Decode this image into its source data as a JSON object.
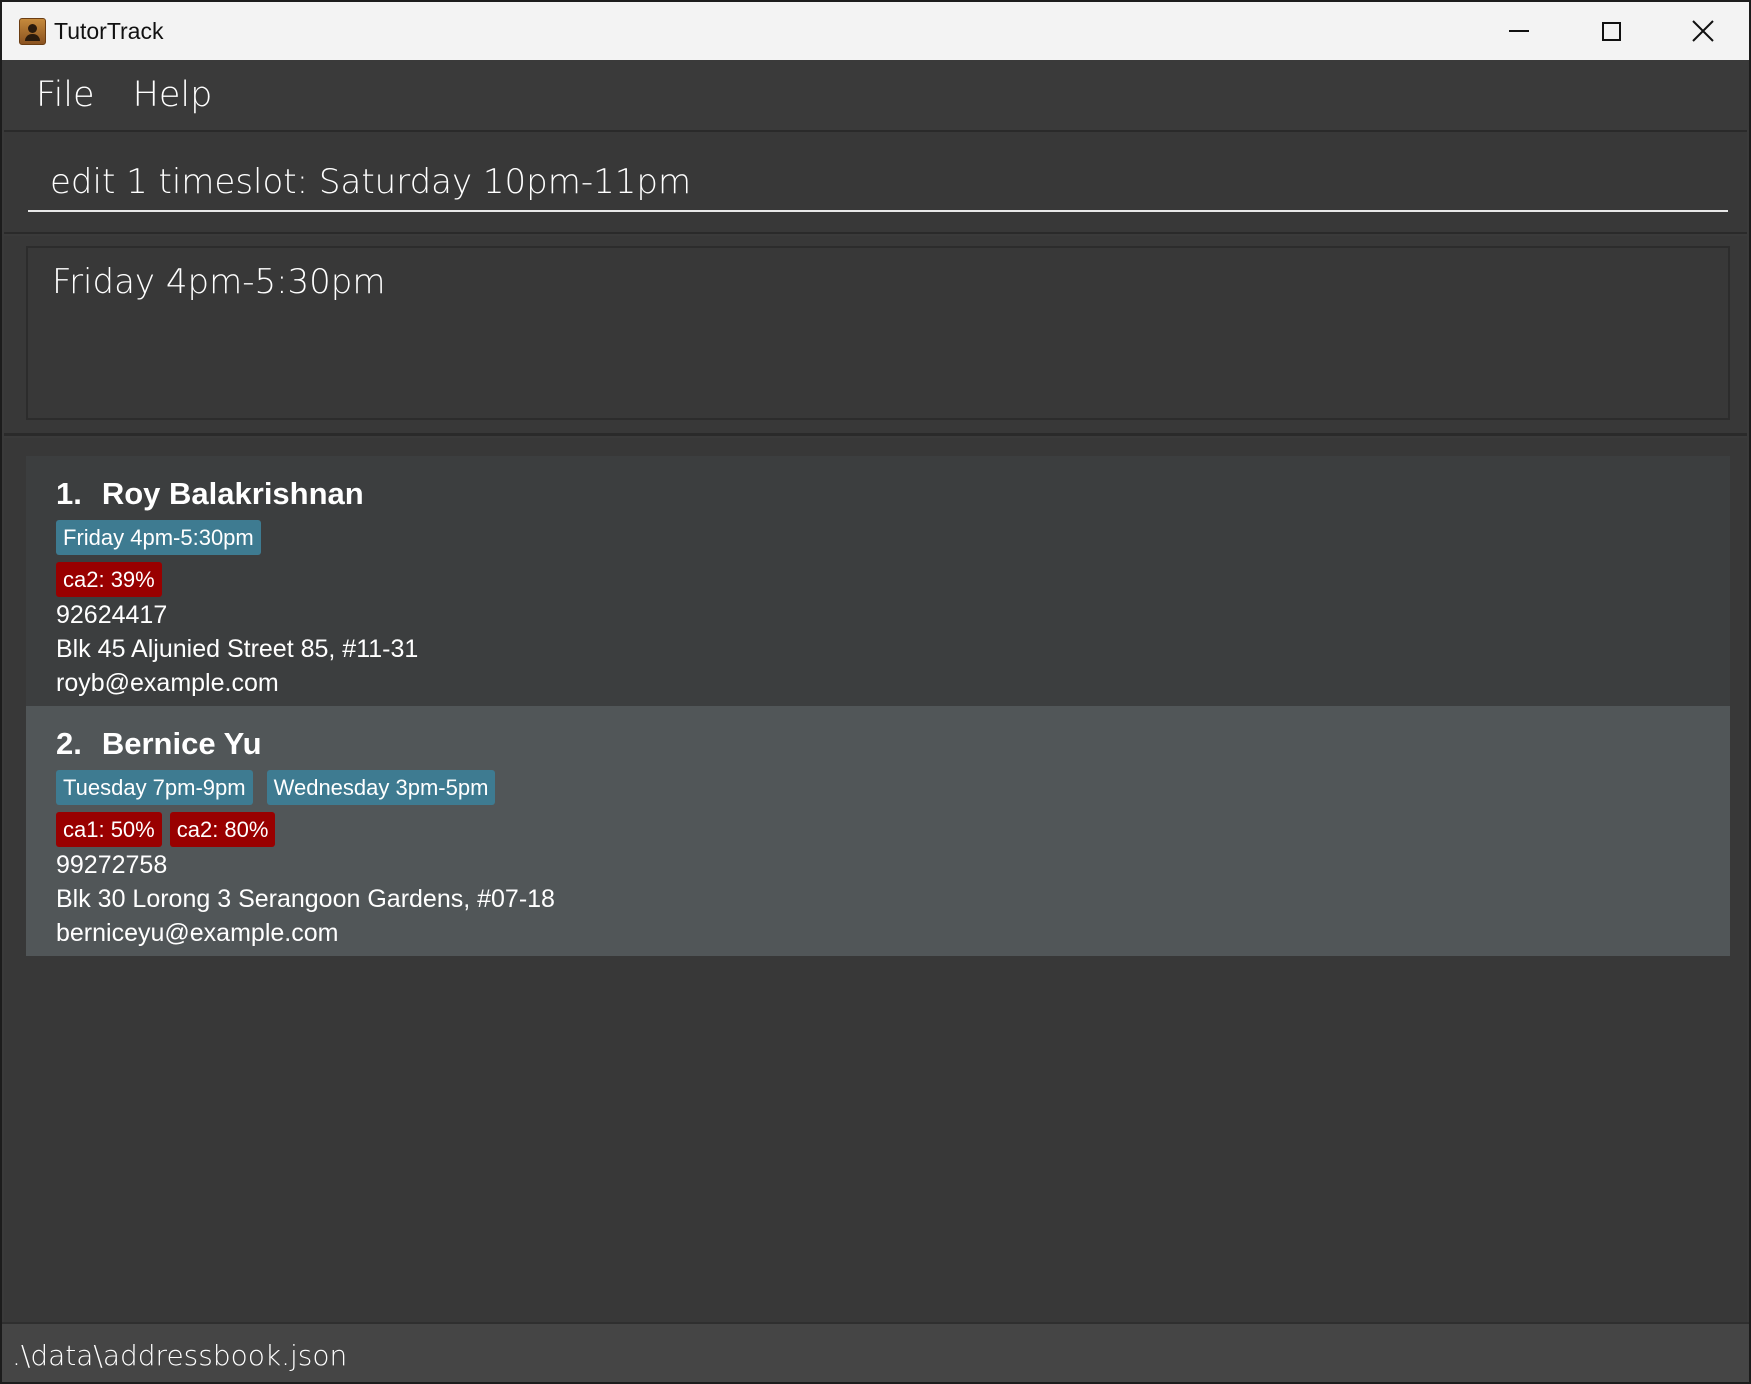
{
  "window": {
    "title": "TutorTrack",
    "icon": "contact-book-icon"
  },
  "menu": {
    "file": "File",
    "help": "Help"
  },
  "command": {
    "value": "edit 1 timeslot: Saturday 10pm-11pm"
  },
  "result": {
    "text": "Friday 4pm-5:30pm"
  },
  "persons": [
    {
      "index": "1.",
      "name": "Roy Balakrishnan",
      "timeslots": [
        "Friday 4pm-5:30pm"
      ],
      "grades": [
        "ca2: 39%"
      ],
      "phone": "92624417",
      "address": "Blk 45 Aljunied Street 85, #11-31",
      "email": "royb@example.com"
    },
    {
      "index": "2.",
      "name": "Bernice Yu",
      "timeslots": [
        "Tuesday 7pm-9pm",
        "Wednesday 3pm-5pm"
      ],
      "grades": [
        "ca1: 50%",
        "ca2: 80%"
      ],
      "phone": "99272758",
      "address": "Blk 30 Lorong 3 Serangoon Gardens, #07-18",
      "email": "berniceyu@example.com"
    }
  ],
  "status": {
    "path": ".\\data\\addressbook.json"
  },
  "colors": {
    "timeslot_tag": "#3e7b91",
    "grade_tag": "#990000",
    "card_selected": "#515658",
    "background": "#383838"
  }
}
